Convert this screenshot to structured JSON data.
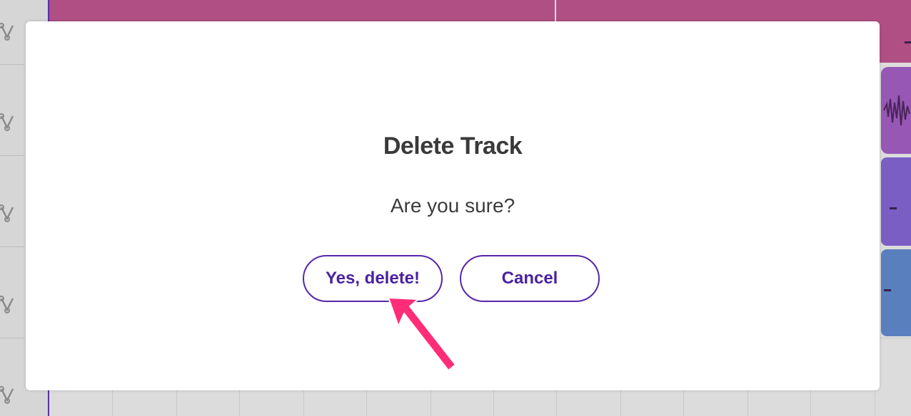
{
  "dialog": {
    "title": "Delete Track",
    "message": "Are you sure?",
    "confirm_label": "Yes, delete!",
    "cancel_label": "Cancel"
  },
  "colors": {
    "accent": "#5527a8",
    "annotation_arrow": "#ff2d78",
    "clip_track_1": "#b04f84",
    "clip_track_2": "#9757b5",
    "clip_track_3": "#7a5ec4",
    "clip_track_4": "#5a7fbe"
  },
  "icons": {
    "track_row": "automation-node-icon",
    "annotation": "pointer-arrow"
  }
}
